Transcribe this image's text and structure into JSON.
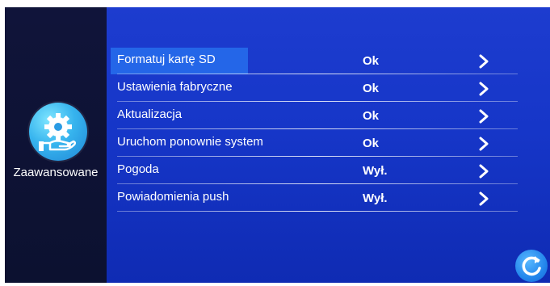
{
  "sidebar": {
    "icon": "gear-hand-icon",
    "label": "Zaawansowane"
  },
  "menu": {
    "items": [
      {
        "label": "Formatuj kartę SD",
        "value": "Ok",
        "selected": true
      },
      {
        "label": "Ustawienia fabryczne",
        "value": "Ok"
      },
      {
        "label": "Aktualizacja",
        "value": "Ok"
      },
      {
        "label": "Uruchom ponownie system",
        "value": "Ok"
      },
      {
        "label": "Pogoda",
        "value": "Wył."
      },
      {
        "label": "Powiadomienia push",
        "value": "Wył."
      }
    ]
  },
  "colors": {
    "background": "#1636c8",
    "sidebar": "#10143a",
    "highlight": "#2466e8",
    "text": "#ffffff"
  },
  "corner_button_icon": "refresh-icon"
}
